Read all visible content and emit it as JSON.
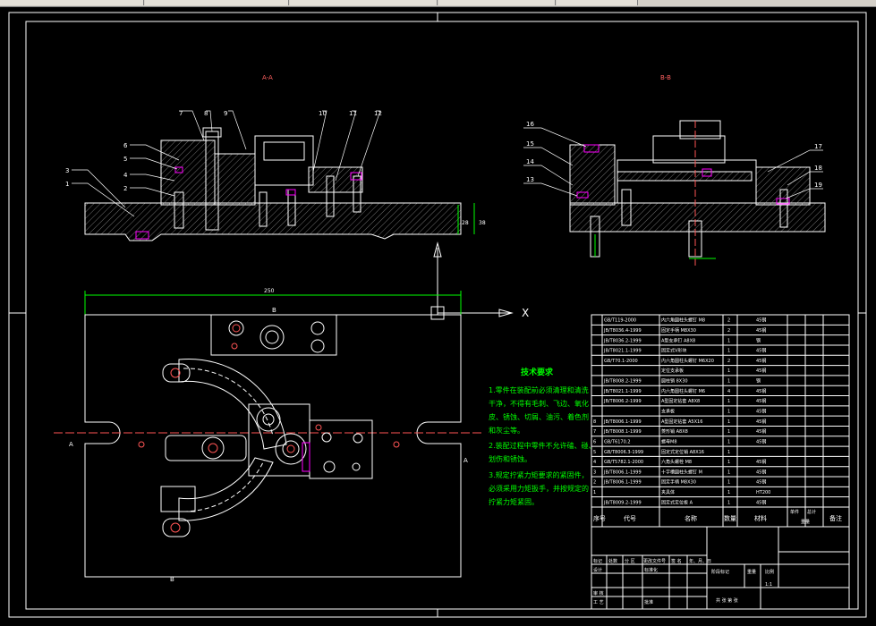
{
  "drawing": {
    "section_a_title": "A-A",
    "section_b_title": "B-B",
    "part_callouts": [
      "1",
      "2",
      "3",
      "4",
      "5",
      "6",
      "7",
      "8",
      "9",
      "10",
      "11",
      "12",
      "13",
      "14",
      "15",
      "16",
      "17",
      "18",
      "19"
    ],
    "dimension_width": "250",
    "section_marks": {
      "b_top": "B",
      "b_bottom": "B",
      "a_left": "A",
      "a_right": "A"
    },
    "ucs_x_label": "X"
  },
  "tech_requirements": {
    "title": "技术要求",
    "lines": [
      "1.零件在装配前必须清理和清洗",
      "干净，不得有毛刺、飞边、氧化",
      "皮、锈蚀、切屑、油污、着色剂",
      "和灰尘等。",
      "2.装配过程中零件不允许磕、碰、",
      "划伤和锈蚀。",
      "3.规定拧紧力矩要求的紧固件，",
      "必须采用力矩扳手，并按规定的",
      "拧紧力矩紧固。"
    ]
  },
  "bom": {
    "rows": [
      {
        "no": "",
        "code": "GB/T119-2000",
        "name": "内六角圆柱头螺钉 M8",
        "qty": "2",
        "mat": "45钢"
      },
      {
        "no": "",
        "code": "JB/T8036.4-1999",
        "name": "固定手柄 M8X30",
        "qty": "2",
        "mat": "45钢"
      },
      {
        "no": "",
        "code": "JB/T8036.2-1999",
        "name": "A型支承钉 A8X8",
        "qty": "1",
        "mat": "钢"
      },
      {
        "no": "",
        "code": "JB/T8021.1-1999",
        "name": "固定式V形块",
        "qty": "1",
        "mat": "45钢"
      },
      {
        "no": "",
        "code": "GB/T70.1-2000",
        "name": "内六角圆柱头螺钉 M6X20",
        "qty": "2",
        "mat": "45钢"
      },
      {
        "no": "",
        "code": "",
        "name": "定位支承板",
        "qty": "1",
        "mat": "45钢"
      },
      {
        "no": "",
        "code": "JB/T8008.2-1999",
        "name": "圆柱销 8X30",
        "qty": "1",
        "mat": "钢"
      },
      {
        "no": "",
        "code": "JB/T8021.1-1999",
        "name": "内六角圆柱头螺钉 M6",
        "qty": "4",
        "mat": "45钢"
      },
      {
        "no": "",
        "code": "JB/T8006.2-1999",
        "name": "A型固定钻套 A8X8",
        "qty": "1",
        "mat": "45钢"
      },
      {
        "no": "",
        "code": "",
        "name": "支承板",
        "qty": "1",
        "mat": "45钢"
      },
      {
        "no": "8",
        "code": "JB/T8006.1-1999",
        "name": "A型固定钻套 A5X16",
        "qty": "1",
        "mat": "45钢"
      },
      {
        "no": "7",
        "code": "JB/T8008.1-1999",
        "name": "菱形销 A8X8",
        "qty": "1",
        "mat": "45钢"
      },
      {
        "no": "6",
        "code": "GB/T6170.2",
        "name": "螺母M8",
        "qty": "1",
        "mat": "45钢"
      },
      {
        "no": "5",
        "code": "GB/T8006.3-1999",
        "name": "固定式定位销 A8X16",
        "qty": "1",
        "mat": ""
      },
      {
        "no": "4",
        "code": "GB/T5782.1-2000",
        "name": "六角头螺栓 M8",
        "qty": "1",
        "mat": "45钢"
      },
      {
        "no": "3",
        "code": "JB/T8006.1-1999",
        "name": "十字槽圆柱头螺钉 M",
        "qty": "1",
        "mat": "45钢"
      },
      {
        "no": "2",
        "code": "JB/T8006.1-1999",
        "name": "固定手柄 M8X30",
        "qty": "1",
        "mat": "45钢"
      },
      {
        "no": "1",
        "code": "",
        "name": "夹具体",
        "qty": "1",
        "mat": "HT200"
      },
      {
        "no": "",
        "code": "JB/T8009.2-1999",
        "name": "固定式定位板 A",
        "qty": "1",
        "mat": "45钢"
      }
    ],
    "header": {
      "no": "序号",
      "code": "代号",
      "name": "名称",
      "qty": "数量",
      "mat": "材料",
      "unit": "单件",
      "total": "总计",
      "weight": "重量",
      "remark": "备注"
    }
  },
  "title_block": {
    "row1": [
      "标记",
      "处数",
      "分 区",
      "更改文件号",
      "签 名",
      "年、月、日"
    ],
    "design": "设计",
    "standard": "标准化",
    "check": "审 核",
    "process": "工 艺",
    "approve": "批准",
    "stage": "阶段标记",
    "weight": "重量",
    "scale": "比例",
    "scale_val": "1:1",
    "sheets": "共   张  第   张"
  },
  "colors": {
    "background": "#000000",
    "part_line": "#ffffff",
    "hatch": "#cccccc",
    "dimension": "#00ff00",
    "tech_text": "#00ff00",
    "highlight": "#ff00ff",
    "section_mark": "#ff0000"
  }
}
